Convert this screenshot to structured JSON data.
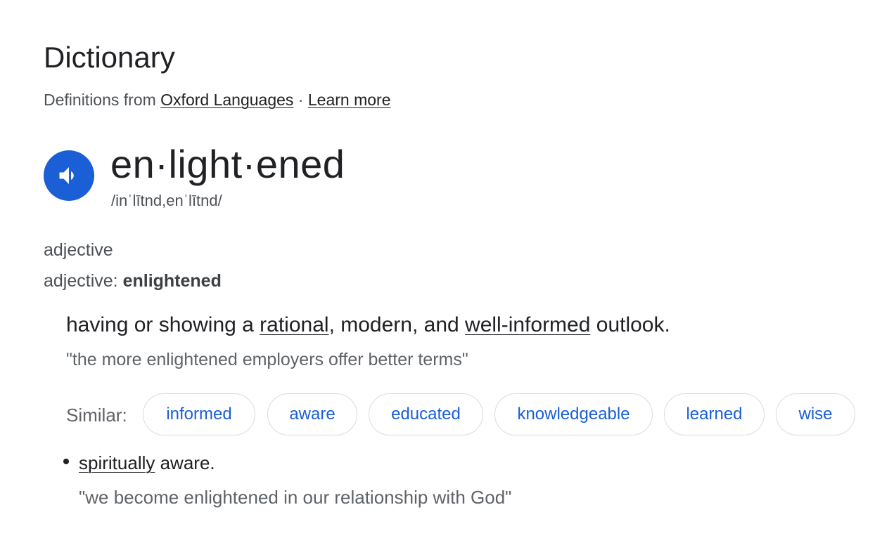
{
  "header": {
    "title": "Dictionary",
    "source_prefix": "Definitions from",
    "source_link": "Oxford Languages",
    "separator": "·",
    "learn_more": "Learn more"
  },
  "entry": {
    "word": "en·light·ened",
    "phonetic": "/inˈlītnd,enˈlītnd/",
    "audio_icon": "speaker-icon"
  },
  "part_of_speech": {
    "label": "adjective",
    "inflection_prefix": "adjective:",
    "inflection_word": "enlightened"
  },
  "sense1": {
    "def_part1": "having or showing a ",
    "link1": "rational",
    "def_part2": ", modern, and ",
    "link2": "well-informed",
    "def_part3": " outlook.",
    "example": "\"the more enlightened employers offer better terms\"",
    "similar_label": "Similar:",
    "similar": [
      "informed",
      "aware",
      "educated",
      "knowledgeable",
      "learned",
      "wise"
    ]
  },
  "sense2": {
    "link": "spiritually",
    "def_rest": " aware.",
    "example": "\"we become enlightened in our relationship with God\""
  },
  "colors": {
    "accent_blue": "#1a5fd6",
    "text_primary": "#202124",
    "text_secondary": "#5f6368",
    "chip_border": "#dadce0"
  }
}
